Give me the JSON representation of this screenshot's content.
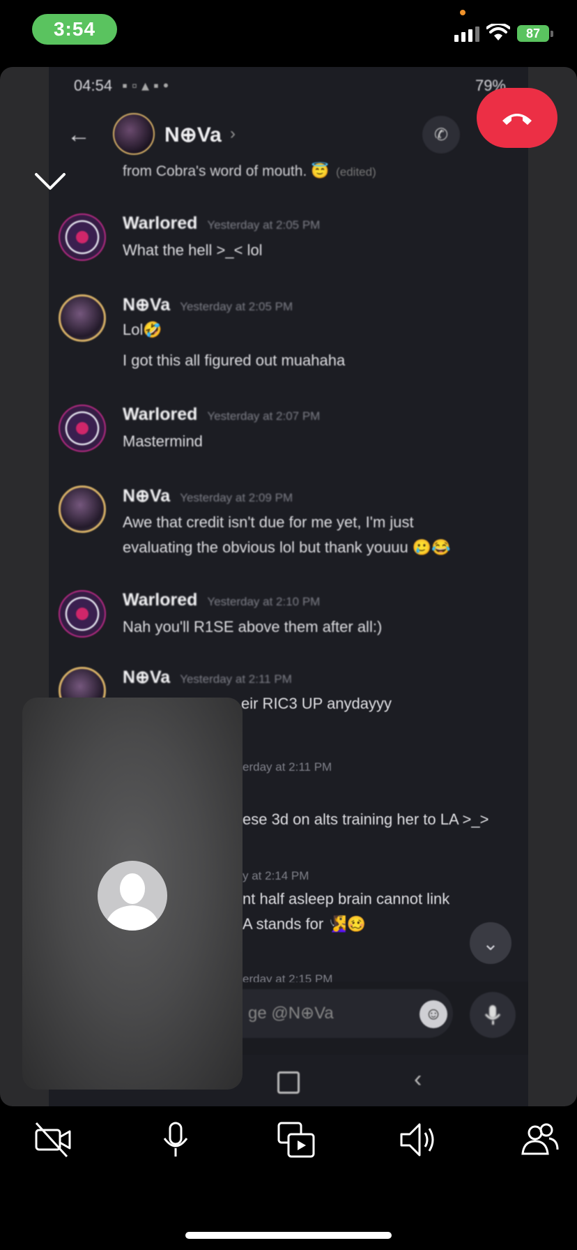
{
  "status_bar": {
    "time": "3:54",
    "battery": "87"
  },
  "shared_screen": {
    "android_status": {
      "time": "04:54",
      "battery": "79%"
    },
    "chat_header": {
      "name": "N⊕Va",
      "chevron": "›"
    },
    "previous_line": {
      "text": "from Cobra's word of mouth. 😇",
      "edited": "(edited)"
    },
    "messages": [
      {
        "author": "Warlored",
        "timestamp": "Yesterday at 2:05 PM",
        "lines": [
          "What the hell >_< lol"
        ]
      },
      {
        "author": "N⊕Va",
        "timestamp": "Yesterday at 2:05 PM",
        "lines": [
          "Lol🤣",
          "I got this all figured out muahaha"
        ]
      },
      {
        "author": "Warlored",
        "timestamp": "Yesterday at 2:07 PM",
        "lines": [
          "Mastermind"
        ]
      },
      {
        "author": "N⊕Va",
        "timestamp": "Yesterday at 2:09 PM",
        "lines": [
          "Awe that credit isn't due for me yet, I'm just",
          "evaluating the obvious lol but thank youuu 🥲😂"
        ]
      },
      {
        "author": "Warlored",
        "timestamp": "Yesterday at 2:10 PM",
        "lines": [
          "Nah you'll R1SE above them after all:)"
        ]
      },
      {
        "author": "N⊕Va",
        "timestamp": "Yesterday at 2:11 PM",
        "lines": [
          "eir RIC3 UP anydayyy"
        ]
      }
    ],
    "partial_lines": {
      "ts1": "erday at 2:11 PM",
      "line1": "ese 3d on alts training her to LA >_>",
      "ts2": "y at 2:14 PM",
      "line2": "nt half asleep brain cannot link",
      "line3": "A stands for 🧏‍♀️🥴",
      "ts3": "erday at 2:15 PM"
    },
    "input_placeholder": "ge @N⊕Va"
  },
  "icons": {
    "collapse": "chevron-down-icon",
    "end_call": "hang-up-icon",
    "camera": "camera-off-icon",
    "mic": "microphone-icon",
    "share": "screen-share-icon",
    "speaker": "speaker-icon",
    "participants": "participants-icon"
  },
  "colors": {
    "end_call": "#ec2f45",
    "time_pill": "#5ac35f"
  }
}
